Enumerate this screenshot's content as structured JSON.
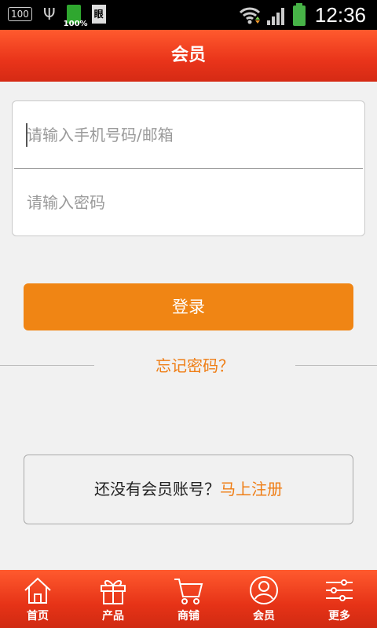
{
  "status_bar": {
    "notification_count": "100",
    "battery_small_label": "100%",
    "doc_icon_label": "眼",
    "time": "12:36"
  },
  "header": {
    "title": "会员"
  },
  "login_form": {
    "phone_placeholder": "请输入手机号码/邮箱",
    "password_placeholder": "请输入密码",
    "login_label": "登录",
    "forgot_label": "忘记密码？"
  },
  "register": {
    "prompt": "还没有会员账号？",
    "link_label": "马上注册"
  },
  "tabbar": {
    "items": [
      {
        "label": "首页",
        "icon": "home-icon"
      },
      {
        "label": "产品",
        "icon": "gift-icon"
      },
      {
        "label": "商铺",
        "icon": "cart-icon"
      },
      {
        "label": "会员",
        "icon": "member-icon"
      },
      {
        "label": "更多",
        "icon": "settings-sliders-icon"
      }
    ]
  },
  "colors": {
    "accent_orange": "#f08514",
    "header_red": "#e9341a",
    "link_orange": "#ef7d14"
  }
}
